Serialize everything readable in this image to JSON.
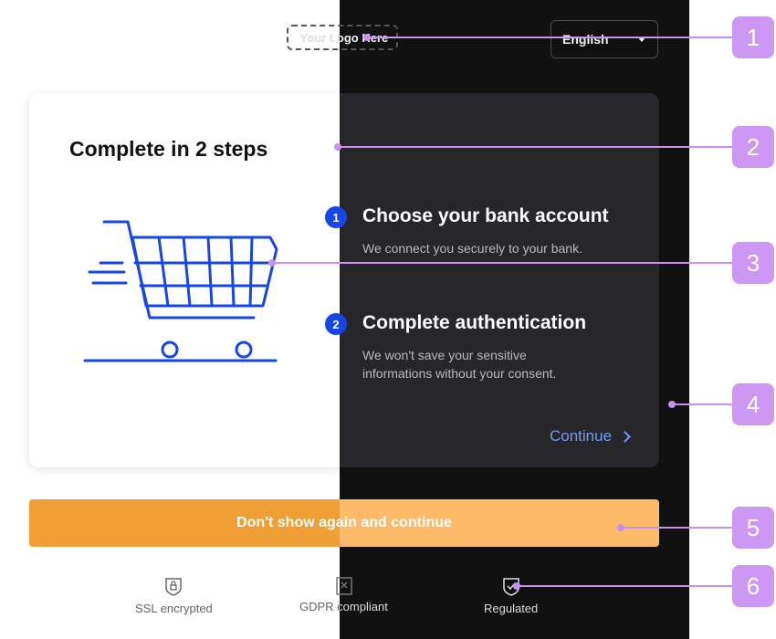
{
  "header": {
    "logo_text": "Your Logo Here",
    "language": "English"
  },
  "card": {
    "title": "Complete in 2 steps",
    "cart_icon": "shopping-cart-icon",
    "steps": [
      {
        "number": "1",
        "title": "Choose your bank account",
        "description": "We connect you securely to your bank."
      },
      {
        "number": "2",
        "title": "Complete authentication",
        "description_line1": "We won't save your sensitive",
        "description_line2": "informations without your consent."
      }
    ],
    "continue_label": "Continue"
  },
  "primary_button": {
    "label": "Don't show again and continue"
  },
  "footer": {
    "badges": [
      {
        "label": "SSL encrypted",
        "icon": "lock-shield-icon"
      },
      {
        "label": "GDPR compliant",
        "icon": "gdpr-document-icon"
      },
      {
        "label": "Regulated",
        "icon": "check-shield-icon"
      }
    ]
  },
  "callouts": [
    "1",
    "2",
    "3",
    "4",
    "5",
    "6"
  ],
  "colors": {
    "accent_blue": "#1646e6",
    "link_blue": "#6f9cf5",
    "button_orange": "#ef9f35",
    "button_orange_light": "#fdbb6a",
    "callout_purple": "#cd97f4",
    "dark_bg": "#111111",
    "dark_card": "#27272b"
  }
}
